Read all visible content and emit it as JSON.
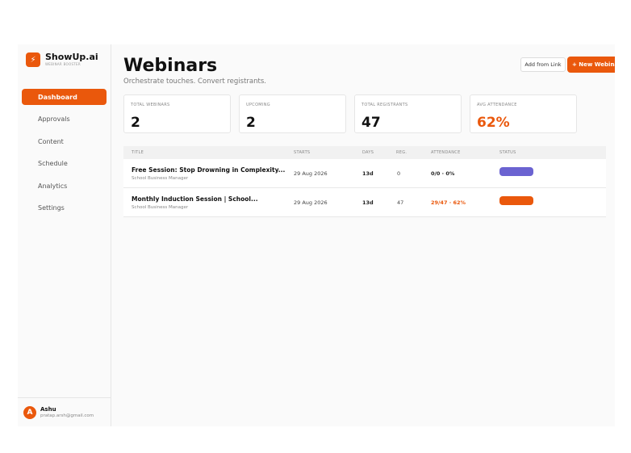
{
  "brand": {
    "name": "ShowUp.ai",
    "tagline": "WEBINAR BOOSTER",
    "logo_icon": "bolt-icon"
  },
  "nav": [
    {
      "label": "Dashboard",
      "active": true
    },
    {
      "label": "Approvals",
      "active": false
    },
    {
      "label": "Content",
      "active": false
    },
    {
      "label": "Schedule",
      "active": false
    },
    {
      "label": "Analytics",
      "active": false
    },
    {
      "label": "Settings",
      "active": false
    }
  ],
  "user": {
    "initial": "A",
    "name": "Ashu",
    "email": "pratap.arsh@gmail.com"
  },
  "header": {
    "title": "Webinars",
    "subtitle": "Orchestrate touches. Convert registrants.",
    "add_link_label": "Add from Link",
    "new_label": "+ New Webinar"
  },
  "stats": [
    {
      "label": "TOTAL WEBINARS",
      "value": "2"
    },
    {
      "label": "UPCOMING",
      "value": "2"
    },
    {
      "label": "TOTAL REGISTRANTS",
      "value": "47"
    },
    {
      "label": "AVG ATTENDANCE",
      "value": "62%"
    }
  ],
  "table": {
    "columns": [
      "TITLE",
      "STARTS",
      "DAYS",
      "REG.",
      "ATTENDANCE",
      "STATUS"
    ],
    "rows": [
      {
        "title": "Free Session: Stop Drowning in Complexity...",
        "subtitle": "School Business Manager",
        "starts": "29 Aug 2026",
        "days": "13d",
        "reg": "0",
        "attendance": "0/0 · 0%"
      },
      {
        "title": "Monthly Induction Session | School...",
        "subtitle": "School Business Manager",
        "starts": "29 Aug 2026",
        "days": "13d",
        "reg": "47",
        "attendance": "29/47 · 62%"
      }
    ]
  },
  "colors": {
    "accent": "#ea580c",
    "status_purple": "#6b63d1",
    "status_orange": "#ea580c"
  }
}
